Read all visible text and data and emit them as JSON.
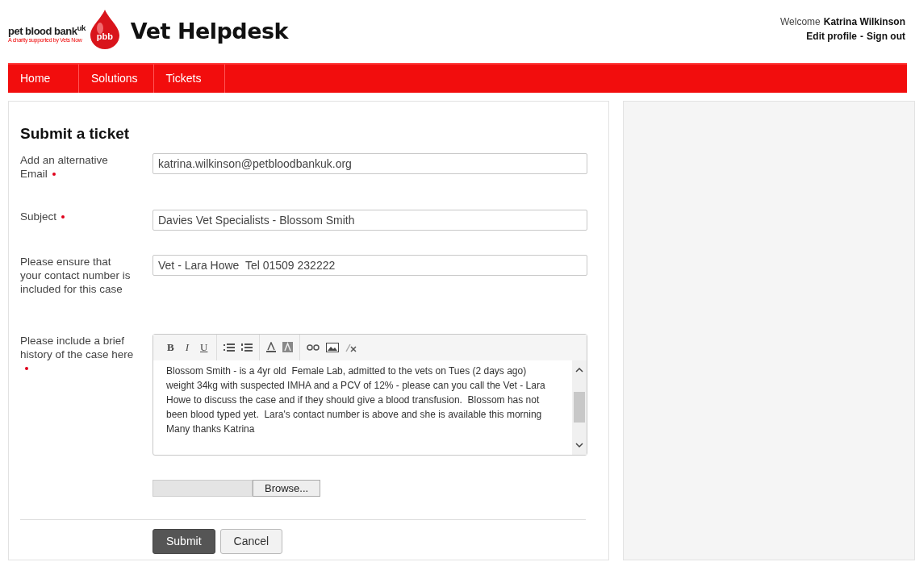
{
  "logo": {
    "name": "pet blood bank",
    "superscript": "uk",
    "tagline": "A charity supported by Vets Now",
    "badge": "pbb"
  },
  "site_title": "Vet Helpdesk",
  "user": {
    "greeting": "Welcome",
    "name": "Katrina Wilkinson",
    "edit_profile": "Edit profile",
    "separator": "-",
    "sign_out": "Sign out"
  },
  "nav": [
    {
      "label": "Home"
    },
    {
      "label": "Solutions"
    },
    {
      "label": "Tickets"
    }
  ],
  "form": {
    "title": "Submit a ticket",
    "fields": [
      {
        "kind": "text",
        "label": "Add an alternative Email",
        "required": true,
        "value": "katrina.wilkinson@petbloodbankuk.org"
      },
      {
        "kind": "text",
        "label": "Subject",
        "required": true,
        "value": "Davies Vet Specialists - Blossom Smith"
      },
      {
        "kind": "text",
        "label": "Please ensure that your contact number is included for this case",
        "required": false,
        "value": "Vet - Lara Howe  Tel 01509 232222"
      },
      {
        "kind": "editor",
        "label": "Please include a brief history of the case here",
        "required": true,
        "toolbar": [
          [
            {
              "kind": "bold",
              "label": "B"
            },
            {
              "kind": "italic",
              "label": "I"
            },
            {
              "kind": "underline",
              "label": "U"
            }
          ],
          [
            {
              "kind": "bulleted-list"
            },
            {
              "kind": "numbered-list"
            }
          ],
          [
            {
              "kind": "text-color"
            },
            {
              "kind": "background-color"
            }
          ],
          [
            {
              "kind": "link"
            },
            {
              "kind": "image"
            },
            {
              "kind": "clear-format"
            }
          ]
        ],
        "value": "Blossom Smith - is a 4yr old  Female Lab, admitted to the vets on Tues (2 days ago) weight 34kg with suspected IMHA and a PCV of 12% - please can you call the Vet - Lara Howe to discuss the case and if they should give a blood transfusion.  Blossom has not been blood typed yet.  Lara's contact number is above and she is available this morning Many thanks Katrina"
      }
    ],
    "browse": "Browse...",
    "buttons": [
      {
        "kind": "primary",
        "label": "Submit"
      },
      {
        "kind": "secondary",
        "label": "Cancel"
      }
    ]
  }
}
